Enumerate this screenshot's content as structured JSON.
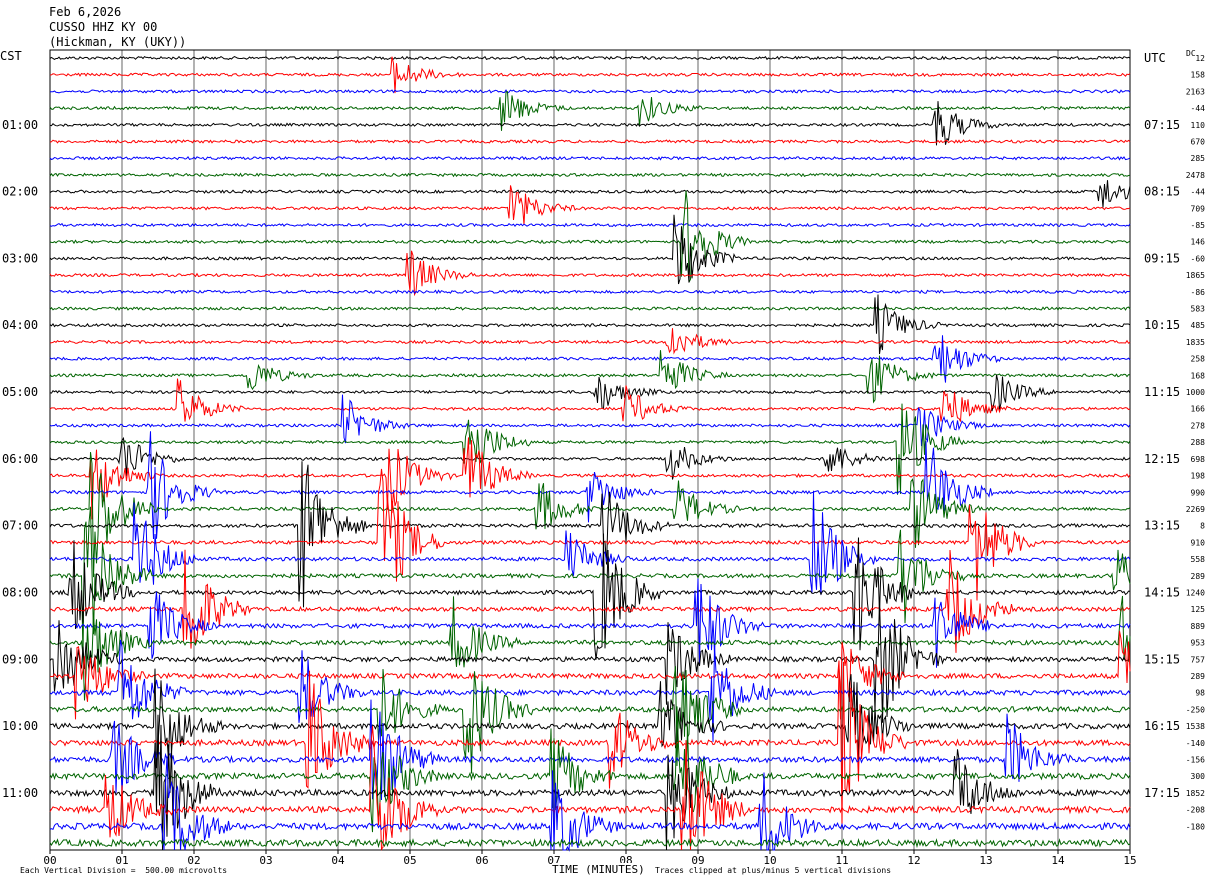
{
  "header": {
    "date": "Feb 6,2026",
    "station": "CUSSO HHZ KY 00",
    "location": "(Hickman, KY (UKY))"
  },
  "left_axis_title": "CST",
  "right_axis_title": "UTC",
  "dc_title": "DC",
  "colors": {
    "trace_cycle": [
      "#000000",
      "#ff0000",
      "#0000ff",
      "#006400"
    ],
    "grid": "#000000"
  },
  "chart_data": {
    "type": "line",
    "description_kind": "helicorder seismogram",
    "xlabel": "TIME (MINUTES)",
    "x_ticks": [
      "00",
      "01",
      "02",
      "03",
      "04",
      "05",
      "06",
      "07",
      "08",
      "09",
      "10",
      "11",
      "12",
      "13",
      "14",
      "15"
    ],
    "xlim": [
      0,
      15
    ],
    "trace_count": 48,
    "left_time_labels": [
      {
        "row": 4,
        "text": "01:00"
      },
      {
        "row": 8,
        "text": "02:00"
      },
      {
        "row": 12,
        "text": "03:00"
      },
      {
        "row": 16,
        "text": "04:00"
      },
      {
        "row": 20,
        "text": "05:00"
      },
      {
        "row": 24,
        "text": "06:00"
      },
      {
        "row": 28,
        "text": "07:00"
      },
      {
        "row": 32,
        "text": "08:00"
      },
      {
        "row": 36,
        "text": "09:00"
      },
      {
        "row": 40,
        "text": "10:00"
      },
      {
        "row": 44,
        "text": "11:00"
      }
    ],
    "right_time_labels": [
      {
        "row": 0,
        "text": "UTC"
      },
      {
        "row": 4,
        "text": "07:15"
      },
      {
        "row": 8,
        "text": "08:15"
      },
      {
        "row": 12,
        "text": "09:15"
      },
      {
        "row": 16,
        "text": "10:15"
      },
      {
        "row": 20,
        "text": "11:15"
      },
      {
        "row": 24,
        "text": "12:15"
      },
      {
        "row": 28,
        "text": "13:15"
      },
      {
        "row": 32,
        "text": "14:15"
      },
      {
        "row": 36,
        "text": "15:15"
      },
      {
        "row": 40,
        "text": "16:15"
      },
      {
        "row": 44,
        "text": "17:15"
      }
    ],
    "dc_offsets": [
      "12",
      "158",
      "2163",
      "-44",
      "110",
      "670",
      "285",
      "2478",
      "-44",
      "709",
      "-85",
      "146",
      "-60",
      "1865",
      "-86",
      "583",
      "485",
      "1835",
      "258",
      "168",
      "1000",
      "166",
      "278",
      "288",
      "698",
      "198",
      "990",
      "2269",
      "8",
      "910",
      "558",
      "289",
      "1240",
      "125",
      "889",
      "953",
      "757",
      "289",
      "98",
      "-250",
      "1538",
      "-140",
      "-156",
      "300",
      "1852",
      "-208",
      "-180",
      ""
    ],
    "activity": [
      [],
      [
        {
          "x": 4.8,
          "a": 1.2
        }
      ],
      [],
      [
        {
          "x": 6.3,
          "a": 1.5
        },
        {
          "x": 8.2,
          "a": 1.2
        }
      ],
      [
        {
          "x": 12.3,
          "a": 2
        }
      ],
      [],
      [],
      [],
      [
        {
          "x": 14.6,
          "a": 1.3
        }
      ],
      [
        {
          "x": 6.4,
          "a": 2
        }
      ],
      [],
      [
        {
          "x": 8.8,
          "a": 4
        }
      ],
      [
        {
          "x": 8.7,
          "a": 3
        }
      ],
      [
        {
          "x": 5.0,
          "a": 1.8
        }
      ],
      [],
      [],
      [
        {
          "x": 11.5,
          "a": 2
        }
      ],
      [
        {
          "x": 8.6,
          "a": 1.5
        }
      ],
      [
        {
          "x": 12.3,
          "a": 2.5
        }
      ],
      [
        {
          "x": 2.8,
          "a": 1.2
        },
        {
          "x": 8.5,
          "a": 2
        },
        {
          "x": 11.4,
          "a": 2
        }
      ],
      [
        {
          "x": 7.6,
          "a": 1.5
        },
        {
          "x": 13.1,
          "a": 1.5
        }
      ],
      [
        {
          "x": 1.8,
          "a": 2
        },
        {
          "x": 8.0,
          "a": 1.5
        },
        {
          "x": 12.4,
          "a": 2
        }
      ],
      [
        {
          "x": 4.1,
          "a": 2
        },
        {
          "x": 12.1,
          "a": 1.5
        }
      ],
      [
        {
          "x": 5.8,
          "a": 3
        },
        {
          "x": 11.8,
          "a": 4
        }
      ],
      [
        {
          "x": 1.0,
          "a": 2
        },
        {
          "x": 8.6,
          "a": 1.5
        },
        {
          "x": 10.8,
          "a": 1.5
        }
      ],
      [
        {
          "x": 0.6,
          "a": 3
        },
        {
          "x": 4.7,
          "a": 3
        },
        {
          "x": 5.8,
          "a": 3
        }
      ],
      [
        {
          "x": 1.4,
          "a": 4
        },
        {
          "x": 7.5,
          "a": 2
        },
        {
          "x": 12.2,
          "a": 4
        }
      ],
      [
        {
          "x": 0.6,
          "a": 5
        },
        {
          "x": 6.8,
          "a": 2
        },
        {
          "x": 8.7,
          "a": 2
        },
        {
          "x": 12.0,
          "a": 3
        }
      ],
      [
        {
          "x": 3.5,
          "a": 6
        },
        {
          "x": 7.7,
          "a": 3
        }
      ],
      [
        {
          "x": 4.6,
          "a": 6
        },
        {
          "x": 12.8,
          "a": 5
        }
      ],
      [
        {
          "x": 1.2,
          "a": 4
        },
        {
          "x": 7.2,
          "a": 2
        },
        {
          "x": 10.6,
          "a": 5
        }
      ],
      [
        {
          "x": 0.5,
          "a": 6
        },
        {
          "x": 11.8,
          "a": 4
        },
        {
          "x": 14.8,
          "a": 2
        }
      ],
      [
        {
          "x": 0.3,
          "a": 4
        },
        {
          "x": 7.6,
          "a": 6
        },
        {
          "x": 11.2,
          "a": 5
        }
      ],
      [
        {
          "x": 1.9,
          "a": 5
        },
        {
          "x": 12.5,
          "a": 4
        }
      ],
      [
        {
          "x": 1.4,
          "a": 3
        },
        {
          "x": 9.0,
          "a": 4
        },
        {
          "x": 12.3,
          "a": 3
        }
      ],
      [
        {
          "x": 0.5,
          "a": 4
        },
        {
          "x": 5.6,
          "a": 3
        },
        {
          "x": 14.9,
          "a": 3
        }
      ],
      [
        {
          "x": 0.1,
          "a": 4
        },
        {
          "x": 11.5,
          "a": 6
        },
        {
          "x": 8.6,
          "a": 3
        }
      ],
      [
        {
          "x": 0.4,
          "a": 3
        },
        {
          "x": 14.9,
          "a": 3
        },
        {
          "x": 11.0,
          "a": 3
        }
      ],
      [
        {
          "x": 1.0,
          "a": 4
        },
        {
          "x": 9.2,
          "a": 4
        },
        {
          "x": 3.5,
          "a": 3
        }
      ],
      [
        {
          "x": 5.8,
          "a": 5
        },
        {
          "x": 8.7,
          "a": 5
        },
        {
          "x": 4.6,
          "a": 3
        }
      ],
      [
        {
          "x": 1.5,
          "a": 4
        },
        {
          "x": 11.1,
          "a": 4
        },
        {
          "x": 8.5,
          "a": 3
        }
      ],
      [
        {
          "x": 3.6,
          "a": 5
        },
        {
          "x": 11.0,
          "a": 6
        },
        {
          "x": 7.8,
          "a": 3
        }
      ],
      [
        {
          "x": 4.5,
          "a": 5
        },
        {
          "x": 0.9,
          "a": 3
        },
        {
          "x": 13.3,
          "a": 3
        }
      ],
      [
        {
          "x": 8.7,
          "a": 6
        },
        {
          "x": 4.5,
          "a": 4
        },
        {
          "x": 7.0,
          "a": 3
        }
      ],
      [
        {
          "x": 1.5,
          "a": 6
        },
        {
          "x": 8.6,
          "a": 4
        },
        {
          "x": 12.6,
          "a": 3
        }
      ],
      [
        {
          "x": 4.5,
          "a": 6
        },
        {
          "x": 8.8,
          "a": 6
        },
        {
          "x": 0.8,
          "a": 3
        }
      ],
      [
        {
          "x": 1.6,
          "a": 5
        },
        {
          "x": 7.0,
          "a": 4
        },
        {
          "x": 9.9,
          "a": 4
        }
      ],
      []
    ]
  },
  "footer": {
    "left": "Each Vertical Division =  500.00 microvolts",
    "right": "Traces clipped at plus/minus 5 vertical divisions"
  }
}
